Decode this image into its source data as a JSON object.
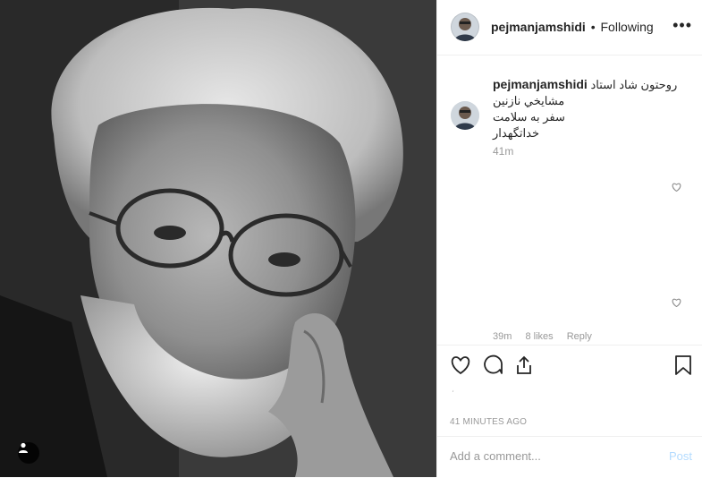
{
  "post": {
    "username": "pejmanjamshidi",
    "separator": "•",
    "follow_status": "Following",
    "more_icon": "more-dots-icon",
    "caption": {
      "author": "pejmanjamshidi",
      "lines": [
        "روحتون شاد استاد",
        "مشايخي نازنين",
        "سفر به سلامت",
        "خداتگهدار"
      ]
    },
    "caption_time": "41m",
    "comment": {
      "time": "39m",
      "likes": "8 likes",
      "reply_label": "Reply"
    },
    "faint_text": "،",
    "timestamp": "41 MINUTES AGO",
    "comment_placeholder": "Add a comment...",
    "post_label": "Post"
  },
  "colors": {
    "accent_disabled": "#b3dbff",
    "border": "#efefef",
    "muted": "#999999"
  }
}
